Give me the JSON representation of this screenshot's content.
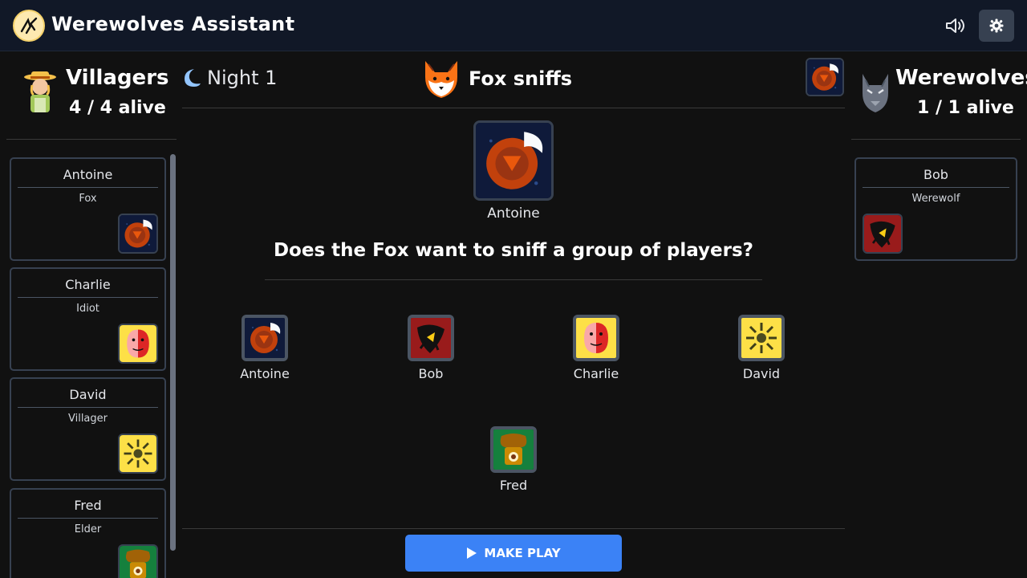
{
  "header": {
    "title": "Werewolves Assistant",
    "sound_icon": "speaker-icon",
    "settings_icon": "gear-icon"
  },
  "villagers": {
    "name": "Villagers",
    "alive": "4 / 4 alive",
    "players": [
      {
        "name": "Antoine",
        "role": "Fox",
        "icon": "fox-icon"
      },
      {
        "name": "Charlie",
        "role": "Idiot",
        "icon": "idiot-icon"
      },
      {
        "name": "David",
        "role": "Villager",
        "icon": "villager-icon"
      },
      {
        "name": "Fred",
        "role": "Elder",
        "icon": "elder-icon"
      }
    ]
  },
  "werewolves": {
    "name": "Werewolves",
    "alive": "1 / 1 alive",
    "players": [
      {
        "name": "Bob",
        "role": "Werewolf",
        "icon": "werewolf-icon"
      }
    ]
  },
  "game": {
    "night_label": "Night 1",
    "phase_title": "Fox sniffs",
    "actor_name": "Antoine",
    "question": "Does the Fox want to sniff a group of players?",
    "choices": [
      {
        "name": "Antoine",
        "icon": "fox-icon"
      },
      {
        "name": "Bob",
        "icon": "werewolf-icon"
      },
      {
        "name": "Charlie",
        "icon": "idiot-icon"
      },
      {
        "name": "David",
        "icon": "villager-icon"
      },
      {
        "name": "Fred",
        "icon": "elder-icon"
      }
    ],
    "make_play_label": "MAKE PLAY"
  },
  "colors": {
    "accent": "#3b82f6",
    "header_bg": "#111827",
    "page_bg": "#111111",
    "card_border": "#374151"
  }
}
